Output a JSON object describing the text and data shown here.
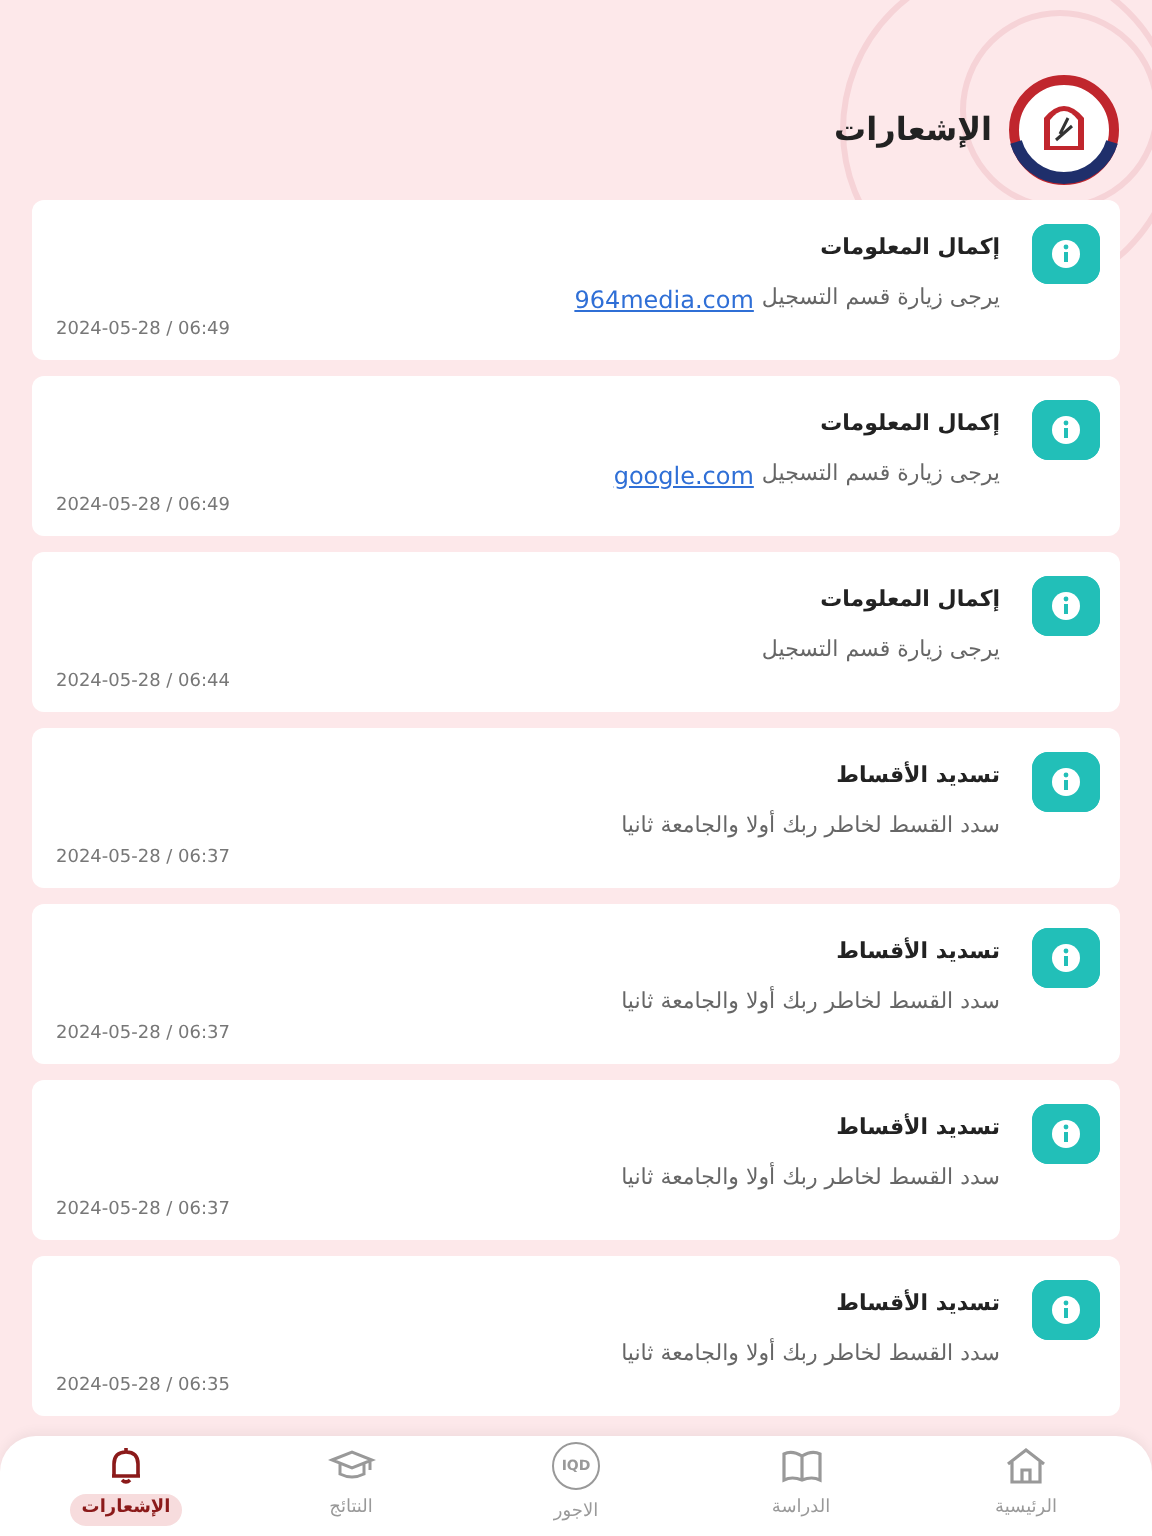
{
  "header": {
    "title": "الإشعارات"
  },
  "notifications": [
    {
      "title": "إكمال المعلومات",
      "body": "يرجى زيارة قسم التسجيل",
      "link": "964media.com",
      "time": "2024-05-28 / 06:49"
    },
    {
      "title": "إكمال المعلومات",
      "body": "يرجى زيارة قسم التسجيل",
      "link": "google.com",
      "time": "2024-05-28 / 06:49"
    },
    {
      "title": "إكمال المعلومات",
      "body": "يرجى زيارة قسم التسجيل",
      "time": "2024-05-28 / 06:44"
    },
    {
      "title": "تسديد الأقساط",
      "body": "سدد القسط لخاطر ربك أولا والجامعة ثانيا",
      "time": "2024-05-28 / 06:37"
    },
    {
      "title": "تسديد الأقساط",
      "body": "سدد القسط لخاطر ربك أولا والجامعة ثانيا",
      "time": "2024-05-28 / 06:37"
    },
    {
      "title": "تسديد الأقساط",
      "body": "سدد القسط لخاطر ربك أولا والجامعة ثانيا",
      "time": "2024-05-28 / 06:37"
    },
    {
      "title": "تسديد الأقساط",
      "body": "سدد القسط لخاطر ربك أولا والجامعة ثانيا",
      "time": "2024-05-28 / 06:35"
    }
  ],
  "bottom_nav": [
    {
      "kind": "home",
      "label": "الرئيسية",
      "selected": false
    },
    {
      "kind": "study",
      "label": "الدراسة",
      "selected": false
    },
    {
      "kind": "fees",
      "label": "الاجور",
      "icon_text": "IQD",
      "selected": false
    },
    {
      "kind": "results",
      "label": "النتائج",
      "selected": false
    },
    {
      "kind": "notifications",
      "label": "الإشعارات",
      "selected": true
    }
  ]
}
